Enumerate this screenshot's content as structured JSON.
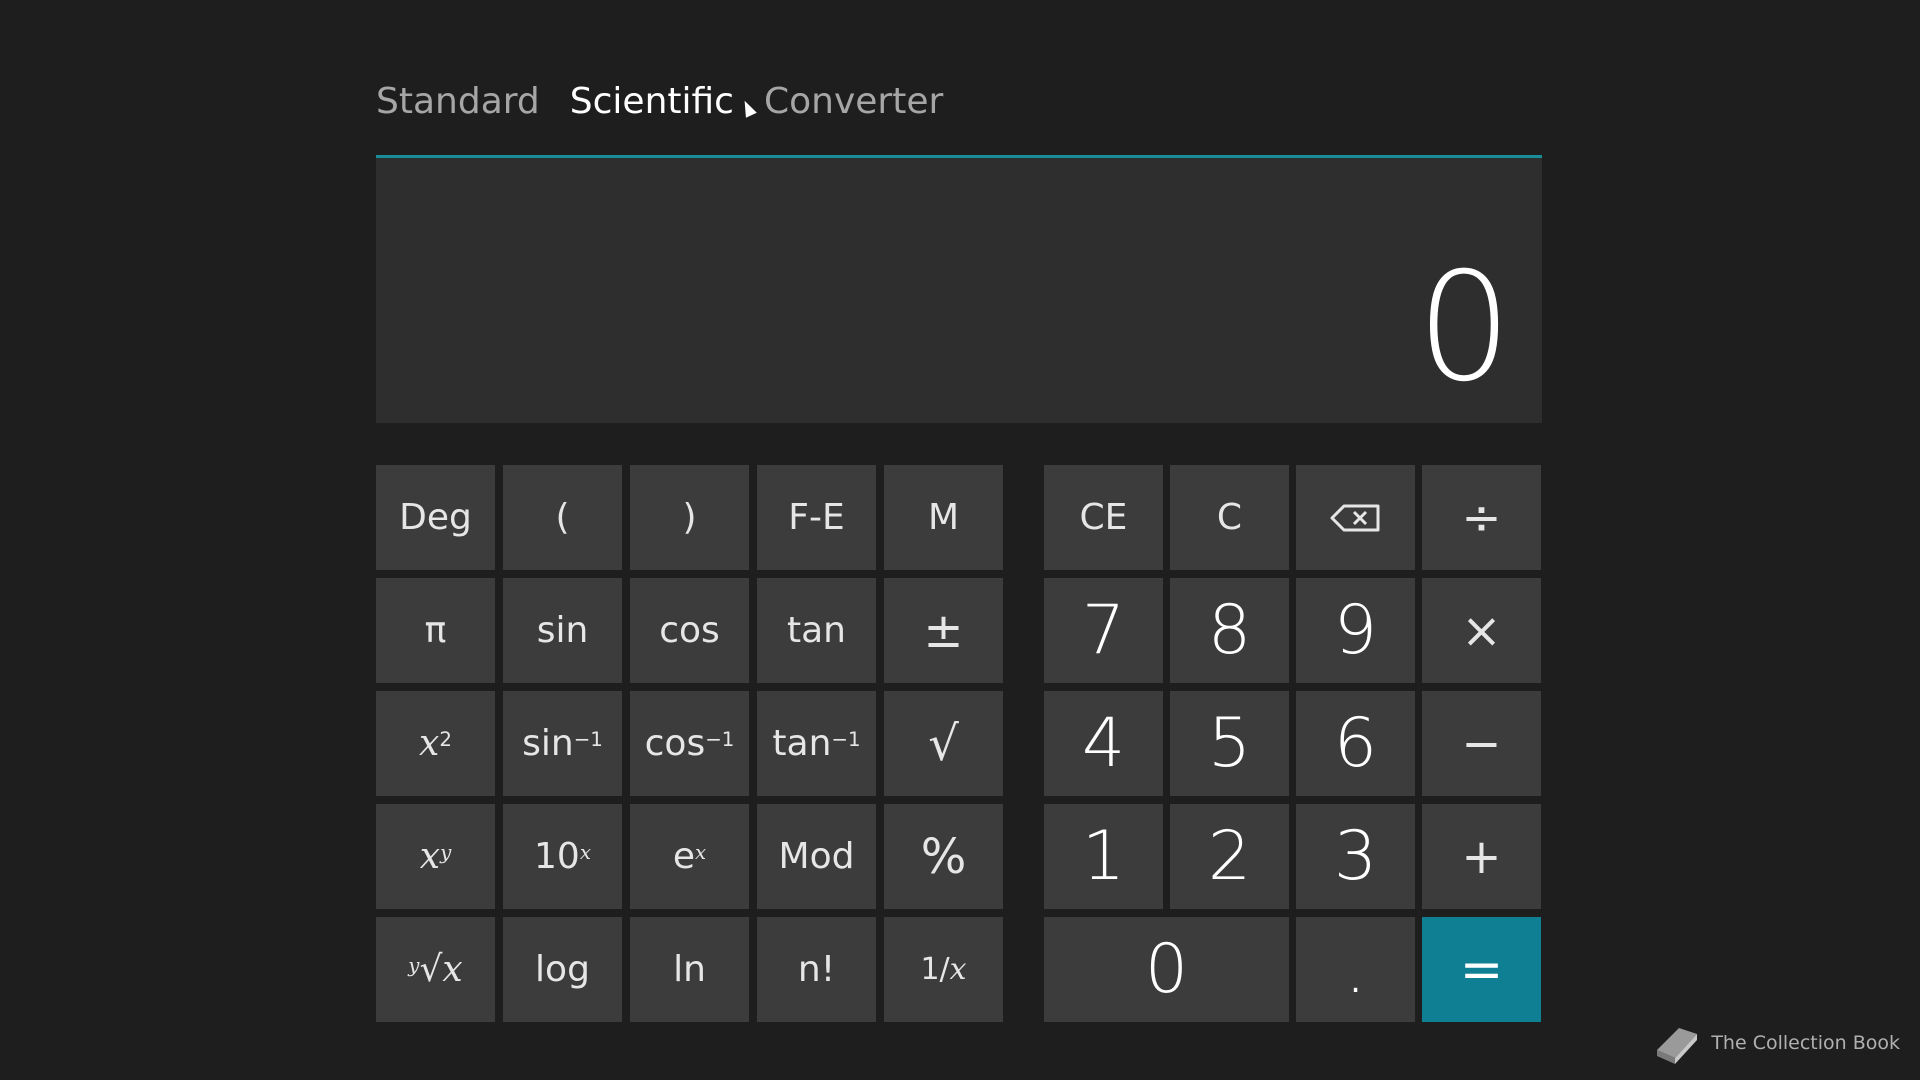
{
  "tabs": [
    {
      "label": "Standard",
      "active": false
    },
    {
      "label": "Scientific",
      "active": true
    },
    {
      "label": "Converter",
      "active": false
    }
  ],
  "display": {
    "value": "0"
  },
  "keys_left": {
    "deg": "Deg",
    "lparen": "(",
    "rparen": ")",
    "fe": "F-E",
    "m": "M",
    "pi": "π",
    "sin": "sin",
    "cos": "cos",
    "tan": "tan",
    "plusminus": "±",
    "x2_base": "x",
    "x2_exp": "2",
    "asin_base": "sin",
    "asin_exp": "−1",
    "acos_base": "cos",
    "acos_exp": "−1",
    "atan_base": "tan",
    "atan_exp": "−1",
    "sqrt": "√",
    "xy_base": "x",
    "xy_exp": "y",
    "tenx_base": "10",
    "tenx_exp": "x",
    "ex_base": "e",
    "ex_exp": "x",
    "mod": "Mod",
    "percent": "%",
    "root_index": "y",
    "root_sign": "√",
    "root_var": "x",
    "log": "log",
    "ln": "ln",
    "fact": "n!",
    "recip_num": "1/",
    "recip_var": "x"
  },
  "keys_right": {
    "ce": "CE",
    "c": "C",
    "backspace_icon": "backspace-icon",
    "divide": "÷",
    "n7": "7",
    "n8": "8",
    "n9": "9",
    "multiply": "×",
    "n4": "4",
    "n5": "5",
    "n6": "6",
    "minus": "−",
    "n1": "1",
    "n2": "2",
    "n3": "3",
    "plus": "+",
    "n0": "0",
    "dot": ".",
    "equals": "="
  },
  "colors": {
    "accent": "#0f7f93",
    "background": "#1e1e1e",
    "key": "#3c3c3c",
    "display": "#2e2e2e"
  },
  "watermark": {
    "text": "The Collection Book",
    "icon": "book-icon"
  }
}
